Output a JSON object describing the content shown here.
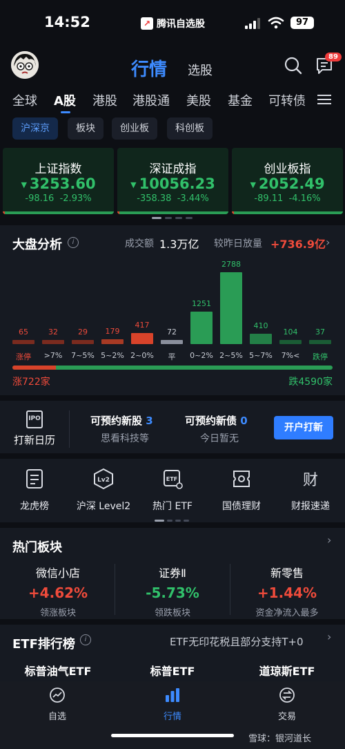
{
  "status_bar": {
    "time": "14:52",
    "app_name": "腾讯自选股",
    "battery": "97"
  },
  "header": {
    "title": "行情",
    "subtitle": "选股",
    "message_badge": "89"
  },
  "market_tabs": [
    "全球",
    "A股",
    "港股",
    "港股通",
    "美股",
    "基金",
    "可转债"
  ],
  "sub_tabs": [
    "沪深京",
    "板块",
    "创业板",
    "科创板"
  ],
  "indices": [
    {
      "name": "上证指数",
      "value": "3253.60",
      "change": "-98.16",
      "pct": "-2.93%",
      "up_fraction": 0.02
    },
    {
      "name": "深证成指",
      "value": "10056.23",
      "change": "-358.38",
      "pct": "-3.44%",
      "up_fraction": 0.02
    },
    {
      "name": "创业板指",
      "value": "2052.49",
      "change": "-89.11",
      "pct": "-4.16%",
      "up_fraction": 0.02
    }
  ],
  "market_analysis": {
    "title": "大盘分析",
    "volume_label": "成交额",
    "volume_value": "1.3万亿",
    "vs_label": "较昨日放量",
    "vs_value": "+736.9亿",
    "up_text": "涨722家",
    "down_text": "跌4590家",
    "up_count": 722,
    "down_count": 4590
  },
  "chart_data": {
    "type": "bar",
    "categories": [
      "涨停",
      ">7%",
      "7~5%",
      "5~2%",
      "2~0%",
      "平",
      "0~2%",
      "2~5%",
      "5~7%",
      "7%<",
      "跌停"
    ],
    "values": [
      65,
      32,
      29,
      179,
      417,
      72,
      1251,
      2788,
      410,
      104,
      37
    ],
    "colors": [
      "#7a2b1f",
      "#7a2b1f",
      "#7a2b1f",
      "#a83a24",
      "#d8432a",
      "#8a8f9c",
      "#2a9c55",
      "#2a9c55",
      "#237f47",
      "#1a5c35",
      "#1a5c35"
    ],
    "label_colors": [
      "#ef4b3b",
      "#ef4b3b",
      "#ef4b3b",
      "#ef4b3b",
      "#ef4b3b",
      "#c8ccd4",
      "#31c06a",
      "#31c06a",
      "#31c06a",
      "#31c06a",
      "#31c06a"
    ],
    "cat_colors": [
      "#ef4b3b",
      "#c8ccd4",
      "#c8ccd4",
      "#c8ccd4",
      "#c8ccd4",
      "#c8ccd4",
      "#c8ccd4",
      "#c8ccd4",
      "#c8ccd4",
      "#c8ccd4",
      "#31c06a"
    ]
  },
  "ipo": {
    "icon_text": "IPO",
    "label": "打新日历",
    "stock_title": "可预约新股",
    "stock_count": "3",
    "stock_sub": "思看科技等",
    "bond_title": "可预约新债",
    "bond_count": "0",
    "bond_sub": "今日暂无",
    "button": "开户打新"
  },
  "quick_actions": [
    {
      "label": "龙虎榜",
      "icon": "list-icon"
    },
    {
      "label": "沪深 Level2",
      "icon": "lv2-icon",
      "icon_text": "Lv2"
    },
    {
      "label": "热门 ETF",
      "icon": "etf-icon",
      "icon_text": "ETF"
    },
    {
      "label": "国债理财",
      "icon": "bond-icon"
    },
    {
      "label": "财报速递",
      "icon": "report-icon",
      "icon_text": "财"
    }
  ],
  "hot_sectors": {
    "title": "热门板块",
    "items": [
      {
        "name": "微信小店",
        "pct": "+4.62%",
        "sub": "领涨板块",
        "color": "#ef4b3b"
      },
      {
        "name": "证券Ⅱ",
        "pct": "-5.73%",
        "sub": "领跌板块",
        "color": "#31c06a"
      },
      {
        "name": "新零售",
        "pct": "+1.44%",
        "sub": "资金净流入最多",
        "color": "#ef4b3b"
      }
    ]
  },
  "etf_rank": {
    "title": "ETF排行榜",
    "note": "ETF无印花税且部分支持T+0",
    "items": [
      {
        "name": "标普油气ETF"
      },
      {
        "name": "标普ETF"
      },
      {
        "name": "道琼斯ETF"
      }
    ]
  },
  "bottom_nav": [
    {
      "label": "自选",
      "icon": "chart-icon"
    },
    {
      "label": "行情",
      "icon": "market-icon"
    },
    {
      "label": "交易",
      "icon": "trade-icon"
    }
  ],
  "watermark": "雪球：银河道长"
}
